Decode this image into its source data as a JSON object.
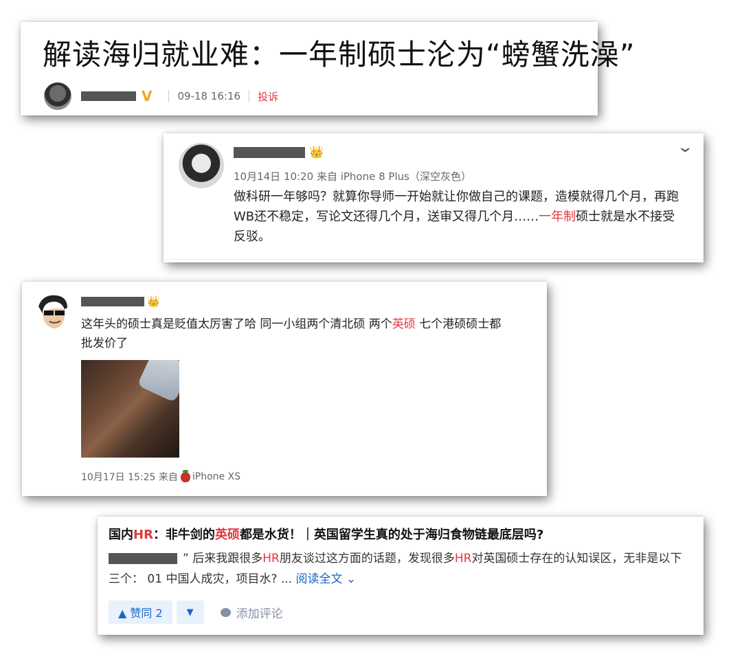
{
  "card1": {
    "title": "解读海归就业难：一年制硕士沦为“螃蟹洗澡”",
    "time": "09-18 16:16",
    "report": "投诉"
  },
  "card2": {
    "time_source": "10月14日 10:20 来自 iPhone 8 Plus（深空灰色）",
    "text_a": "做科研一年够吗？就算你导师一开始就让你做自己的课题，造模就得几个月，再跑WB还不稳定，写论文还得几个月，送审又得几个月……",
    "text_highlight": "一年制",
    "text_b": "硕士就是水不接受反驳。"
  },
  "card3": {
    "text_a": "这年头的硕士真是贬值太厉害了哈 同一小组两个清北硕 两个",
    "text_highlight": "英硕",
    "text_b": " 七个港硕硕士都批发价了",
    "time": "10月17日 15:25",
    "from": "来自",
    "device": "iPhone XS"
  },
  "card4": {
    "title_a": "国内",
    "title_hr": "HR",
    "title_b": "：非牛剑的",
    "title_ys": "英硕",
    "title_c": "都是水货！｜英国留学生真的处于海归食物链最底层吗?",
    "quote": "”",
    "body_a": " 后来我跟很多",
    "body_hr1": "HR",
    "body_b": "朋友谈过这方面的话题，发现很多",
    "body_hr2": "HR",
    "body_c": "对英国硕士存在的认知误区，无非是以下三个： 01 中国人成灾，项目水? ... ",
    "read_more": "阅读全文",
    "upvote": "▲ 赞同 2",
    "downvote": "▼",
    "comment": "添加评论"
  }
}
